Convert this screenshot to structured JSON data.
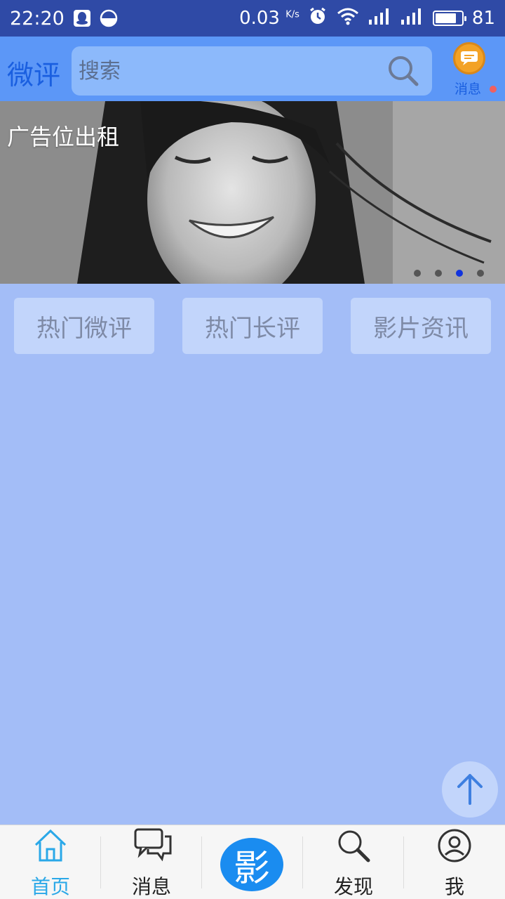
{
  "status_bar": {
    "time": "22:20",
    "net_speed": "0.03",
    "net_unit": "K/s",
    "battery": "81",
    "battery_fraction": 0.81,
    "icons": [
      "qq-icon",
      "half-moon-icon",
      "alarm-icon",
      "wifi-icon",
      "signal-icon",
      "signal-icon",
      "battery-icon"
    ]
  },
  "header": {
    "brand": "微评",
    "search_placeholder": "搜索",
    "message_label": "消息"
  },
  "banner": {
    "caption": "广告位出租",
    "pages": 4,
    "active_page": 3
  },
  "tabs": [
    "热门微评",
    "热门长评",
    "影片资讯"
  ],
  "bottom_nav": {
    "items": [
      {
        "label": "首页",
        "icon": "home-icon",
        "active": true
      },
      {
        "label": "消息",
        "icon": "chat-bubbles-icon",
        "active": false
      },
      {
        "label": "影",
        "icon": "center-brand-button",
        "active": false
      },
      {
        "label": "发现",
        "icon": "search-icon",
        "active": false
      },
      {
        "label": "我",
        "icon": "user-icon",
        "active": false
      }
    ]
  },
  "colors": {
    "status_bar": "#2f4aa6",
    "header": "#5c97f7",
    "content_bg": "#a3bdf7",
    "tab_bg": "#c2d5fb",
    "nav_active": "#2aa8e8",
    "accent_blue": "#1a8cf0"
  }
}
